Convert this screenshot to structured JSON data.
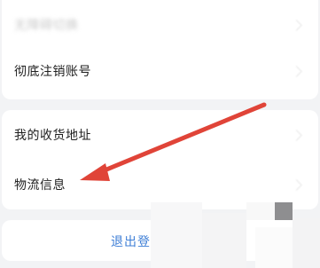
{
  "settings": {
    "items_top": [
      {
        "label": "无障碍切换"
      },
      {
        "label": "彻底注销账号"
      }
    ],
    "items_mid": [
      {
        "label": "我的收货地址"
      },
      {
        "label": "物流信息"
      }
    ],
    "logout_label": "退出登"
  },
  "colors": {
    "accent": "#3f7fd6",
    "annotation_arrow": "#e04438",
    "background": "#f2f3f5"
  },
  "icons": {
    "chevron": "chevron-right-icon",
    "annotation": "arrow-pointer"
  }
}
